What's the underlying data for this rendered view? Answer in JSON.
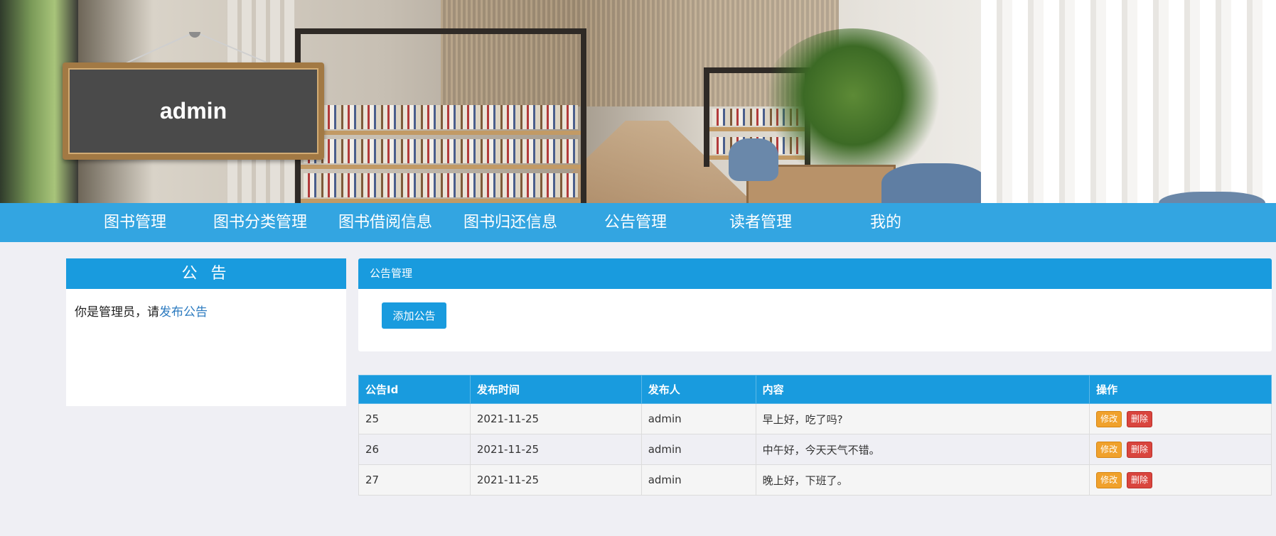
{
  "header": {
    "user_sign": "admin"
  },
  "nav": {
    "items": [
      {
        "label": "图书管理"
      },
      {
        "label": "图书分类管理"
      },
      {
        "label": "图书借阅信息"
      },
      {
        "label": "图书归还信息"
      },
      {
        "label": "公告管理"
      },
      {
        "label": "读者管理"
      },
      {
        "label": "我的"
      }
    ]
  },
  "notice_box": {
    "title": "公 告",
    "text": "你是管理员，请",
    "link": "发布公告"
  },
  "main": {
    "title": "公告管理",
    "add_button": "添加公告",
    "table": {
      "columns": [
        "公告Id",
        "发布时间",
        "发布人",
        "内容",
        "操作"
      ],
      "rows": [
        {
          "id": "25",
          "time": "2021-11-25",
          "publisher": "admin",
          "content": "早上好，吃了吗?"
        },
        {
          "id": "26",
          "time": "2021-11-25",
          "publisher": "admin",
          "content": "中午好，今天天气不错。"
        },
        {
          "id": "27",
          "time": "2021-11-25",
          "publisher": "admin",
          "content": "晚上好，下班了。"
        }
      ],
      "edit_label": "修改",
      "delete_label": "删除"
    }
  },
  "colors": {
    "primary": "#199bde",
    "edit": "#f0a12c",
    "delete": "#d9453e",
    "background": "#efeff4"
  }
}
